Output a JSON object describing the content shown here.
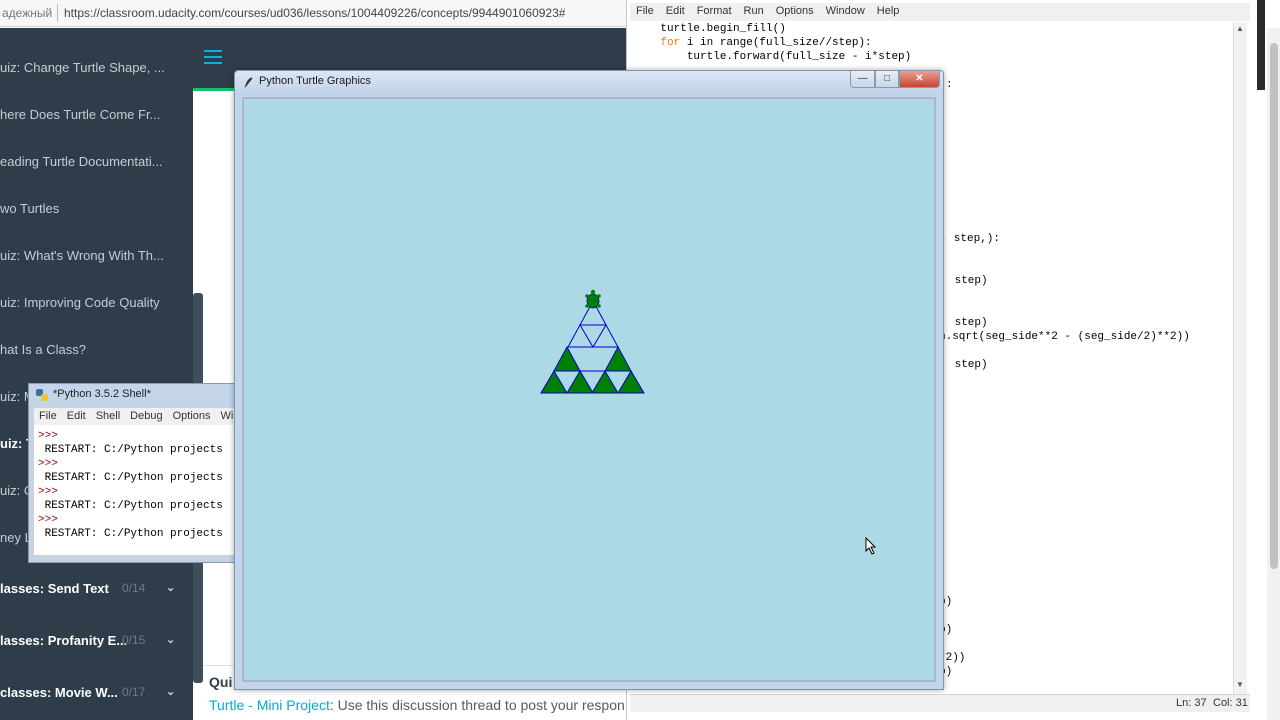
{
  "browser": {
    "secure_label": "адежный",
    "url": "https://classroom.udacity.com/courses/ud036/lessons/1004409226/concepts/9944901060923#"
  },
  "sidebar": {
    "items": [
      {
        "label": "uiz: Change Turtle Shape, ..."
      },
      {
        "label": "here Does Turtle Come Fr..."
      },
      {
        "label": "eading Turtle Documentati..."
      },
      {
        "label": "wo Turtles"
      },
      {
        "label": "uiz: What's Wrong With Th..."
      },
      {
        "label": "uiz: Improving Code Quality"
      },
      {
        "label": "hat Is a Class?"
      },
      {
        "label": "uiz: M"
      },
      {
        "label": "uiz: T"
      },
      {
        "label": "uiz: C"
      },
      {
        "label": "ney L"
      }
    ],
    "lessons": [
      {
        "label": "lasses: Send Text",
        "count": "0/14"
      },
      {
        "label": "lasses: Profanity E...",
        "count": "0/15"
      },
      {
        "label": "classes: Movie W...",
        "count": "0/17"
      }
    ]
  },
  "main": {
    "question_label": "Qui",
    "link_text": "Turtle - Mini Project",
    "body_text": ": Use this discussion thread to post your respon"
  },
  "editor": {
    "menu": [
      "File",
      "Edit",
      "Format",
      "Run",
      "Options",
      "Window",
      "Help"
    ],
    "code_lines": [
      {
        "indent": "    ",
        "kw": "",
        "text": "turtle.begin_fill()"
      },
      {
        "indent": "    ",
        "kw": "for",
        "text": " i in range(full_size//step):"
      },
      {
        "indent": "        ",
        "kw": "",
        "text": "turtle.forward(full_size - i*step)"
      }
    ],
    "partial_lines": [
      {
        "text": ":"
      },
      {
        "text": "e, step,):"
      },
      {
        "text": " step)"
      },
      {
        "text": " step)"
      },
      {
        "text": "h.sqrt(seg_side**2 - (seg_side/2)**2))"
      },
      {
        "text": " step)"
      },
      {
        "text": "p)"
      },
      {
        "text": "p)"
      },
      {
        "text": "*2))"
      },
      {
        "text": "p)"
      }
    ],
    "status_line": "Ln: 37",
    "status_col": "Col: 31"
  },
  "shell": {
    "title": "*Python 3.5.2 Shell*",
    "menu": [
      "File",
      "Edit",
      "Shell",
      "Debug",
      "Options",
      "Wi"
    ],
    "lines": [
      {
        "prompt": ">>>",
        "text": ""
      },
      {
        "prompt": "",
        "text": " RESTART: C:/Python projects"
      },
      {
        "prompt": ">>>",
        "text": ""
      },
      {
        "prompt": "",
        "text": " RESTART: C:/Python projects"
      },
      {
        "prompt": ">>>",
        "text": ""
      },
      {
        "prompt": "",
        "text": " RESTART: C:/Python projects"
      },
      {
        "prompt": ">>>",
        "text": ""
      },
      {
        "prompt": "",
        "text": " RESTART: C:/Python projects"
      }
    ]
  },
  "turtle_window": {
    "title": "Python Turtle Graphics",
    "canvas_color": "#add8e6",
    "fill_color": "#008000",
    "line_color": "#0000cd"
  }
}
